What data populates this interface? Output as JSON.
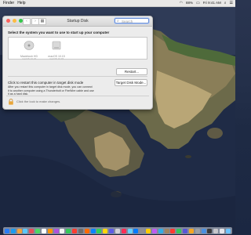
{
  "menubar": {
    "items": [
      "Finder",
      "Help"
    ],
    "status": {
      "battery": "88%",
      "time": "Fri 9:41 AM"
    }
  },
  "window": {
    "title": "Startup Disk",
    "search_placeholder": "Search",
    "heading": "Select the system you want to use to start up your computer",
    "disks": [
      {
        "name": "Macintosh HD",
        "sub": "macOS 10.15"
      },
      {
        "name": "macOS 10.15",
        "sub": "macOS 10.15"
      }
    ],
    "restart_label": "Restart...",
    "target_title": "Click to restart this computer in target disk mode",
    "target_desc": "After you restart this computer in target disk mode, you can connect it to another computer using a Thunderbolt or FireWire cable and use it as a hard disk.",
    "target_button": "Target Disk Mode...",
    "lock_text": "Click the lock to make changes."
  },
  "dock": {
    "icon_colors": [
      "#2a7df5",
      "#1b9bf0",
      "#f2a33a",
      "#5ac8fa",
      "#e84f5a",
      "#4cd964",
      "#ffffff",
      "#ff9500",
      "#af52de",
      "#f2f2f2",
      "#34c759",
      "#fe3c30",
      "#6e6e6e",
      "#ff6a00",
      "#0a84ff",
      "#30d158",
      "#ffd60a",
      "#5e5ce6",
      "#d1d1d6",
      "#ff2d55",
      "#64d2ff",
      "#007aff",
      "#8e8e93",
      "#ffcc00",
      "#bf5af2",
      "#32ade6",
      "#a2845e",
      "#ff3b30",
      "#34c759",
      "#5856d6",
      "#f5a623",
      "#9aa0a6",
      "#4a90e2",
      "#3a3a3c",
      "#c7c7cc",
      "#e5e5ea",
      "#6bc3ff"
    ]
  }
}
